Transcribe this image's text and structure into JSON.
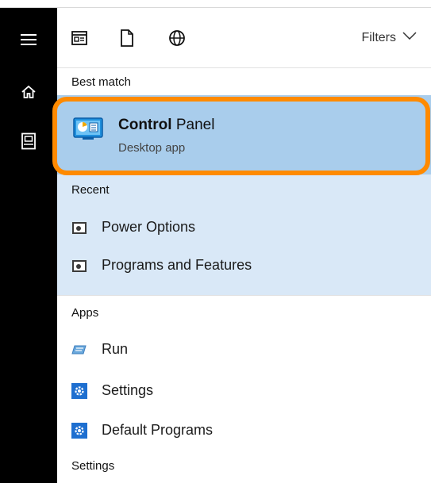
{
  "toolbar": {
    "filters_label": "Filters"
  },
  "best_match": {
    "heading": "Best match",
    "title_bold": "Control",
    "title_rest": " Panel",
    "subtitle": "Desktop app"
  },
  "recent": {
    "heading": "Recent",
    "items": [
      {
        "label": "Power Options",
        "icon": "control-panel-applet-icon"
      },
      {
        "label": "Programs and Features",
        "icon": "control-panel-applet-icon"
      }
    ]
  },
  "apps": {
    "heading": "Apps",
    "items": [
      {
        "label": "Run",
        "icon": "run-icon"
      },
      {
        "label": "Settings",
        "icon": "gear-icon"
      },
      {
        "label": "Default Programs",
        "icon": "gear-icon"
      }
    ]
  },
  "settings": {
    "heading": "Settings"
  },
  "colors": {
    "rail": "#000000",
    "best_match_bg": "#a9cdec",
    "section_bg": "#d9e8f7",
    "highlight_border": "#ff8a00",
    "settings_icon": "#1e6fd0"
  }
}
